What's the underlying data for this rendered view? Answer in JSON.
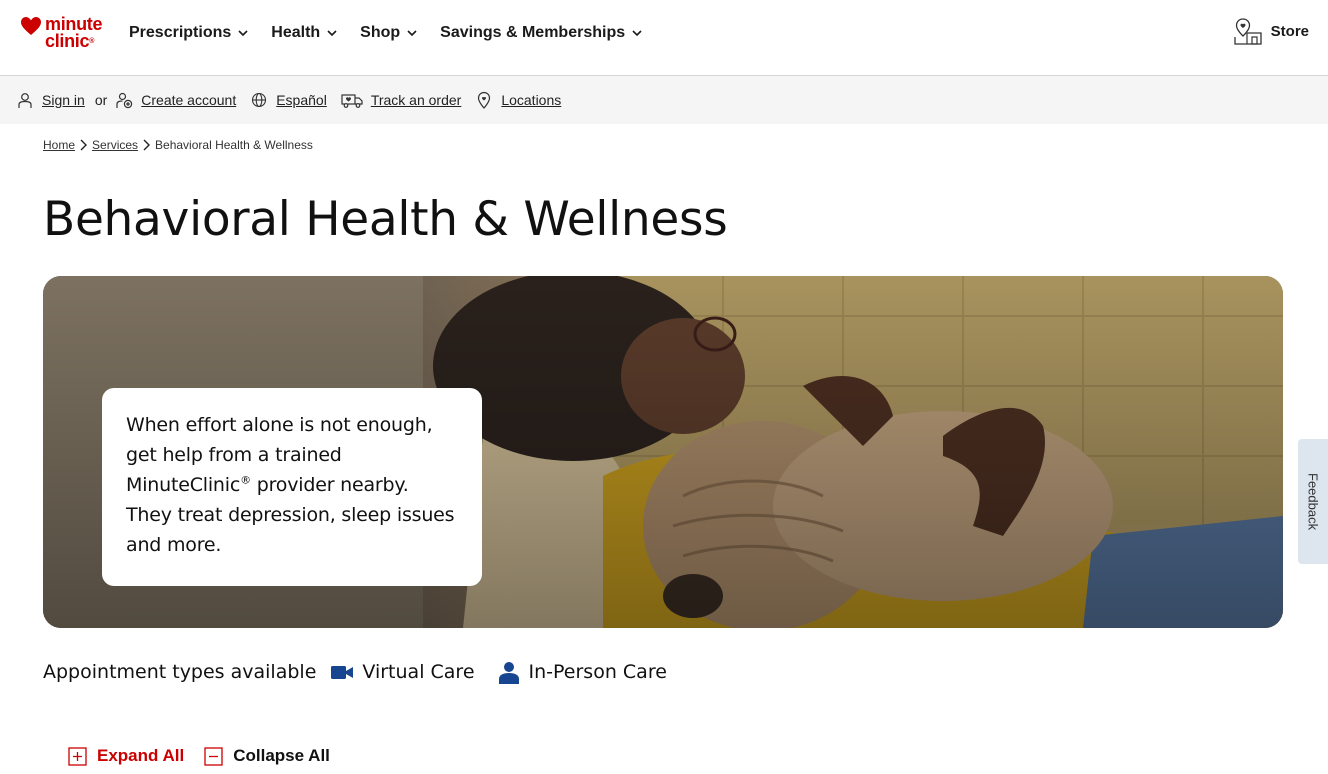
{
  "brand": {
    "line1": "minute",
    "line2": "clinic",
    "reg": "®",
    "color": "#cc0000"
  },
  "main_nav": [
    {
      "label": "Prescriptions"
    },
    {
      "label": "Health"
    },
    {
      "label": "Shop"
    },
    {
      "label": "Savings & Memberships"
    }
  ],
  "store": {
    "label": "Store"
  },
  "util_bar": {
    "sign_in": "Sign in",
    "or": "or",
    "create_account": "Create account",
    "espanol": "Español",
    "track_order": "Track an order",
    "locations": "Locations"
  },
  "breadcrumb": {
    "home": "Home",
    "services": "Services",
    "current": "Behavioral Health & Wellness"
  },
  "page_title": "Behavioral Health & Wellness",
  "hero": {
    "line1": "When effort alone is not enough,",
    "line2": "get help from a trained",
    "brand_word": "MinuteClinic",
    "reg": "®",
    "line3_rest": " provider nearby.",
    "line4": "They treat depression, sleep issues",
    "line5": "and more."
  },
  "appointment": {
    "label": "Appointment types available",
    "virtual": "Virtual Care",
    "in_person": "In-Person Care",
    "icon_color": "#17458f"
  },
  "controls": {
    "expand_all": "Expand All",
    "collapse_all": "Collapse All"
  },
  "feedback": {
    "label": "Feedback"
  }
}
